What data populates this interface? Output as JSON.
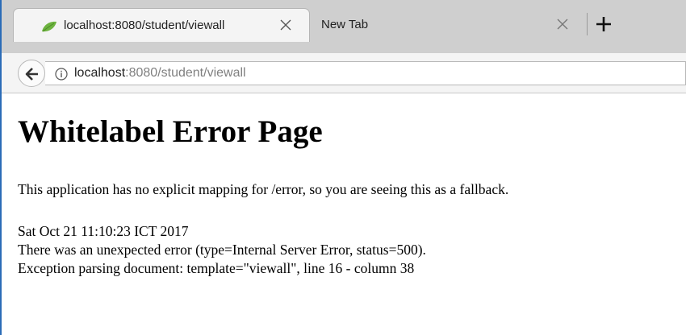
{
  "browser": {
    "tabs": [
      {
        "title": "localhost:8080/student/viewall",
        "active": true,
        "icon": "spring-leaf-icon"
      },
      {
        "title": "New Tab",
        "active": false,
        "icon": ""
      }
    ],
    "new_tab_label": "+",
    "address": {
      "host": "localhost",
      "rest": ":8080/student/viewall"
    }
  },
  "page": {
    "title": "Whitelabel Error Page",
    "message": "This application has no explicit mapping for /error, so you are seeing this as a fallback.",
    "timestamp": "Sat Oct 21 11:10:23 ICT 2017",
    "error_line": "There was an unexpected error (type=Internal Server Error, status=500).",
    "exception_line": "Exception parsing document: template=\"viewall\", line 16 - column 38"
  },
  "colors": {
    "accent": "#2b6cb7",
    "favicon": "#6db33f"
  }
}
